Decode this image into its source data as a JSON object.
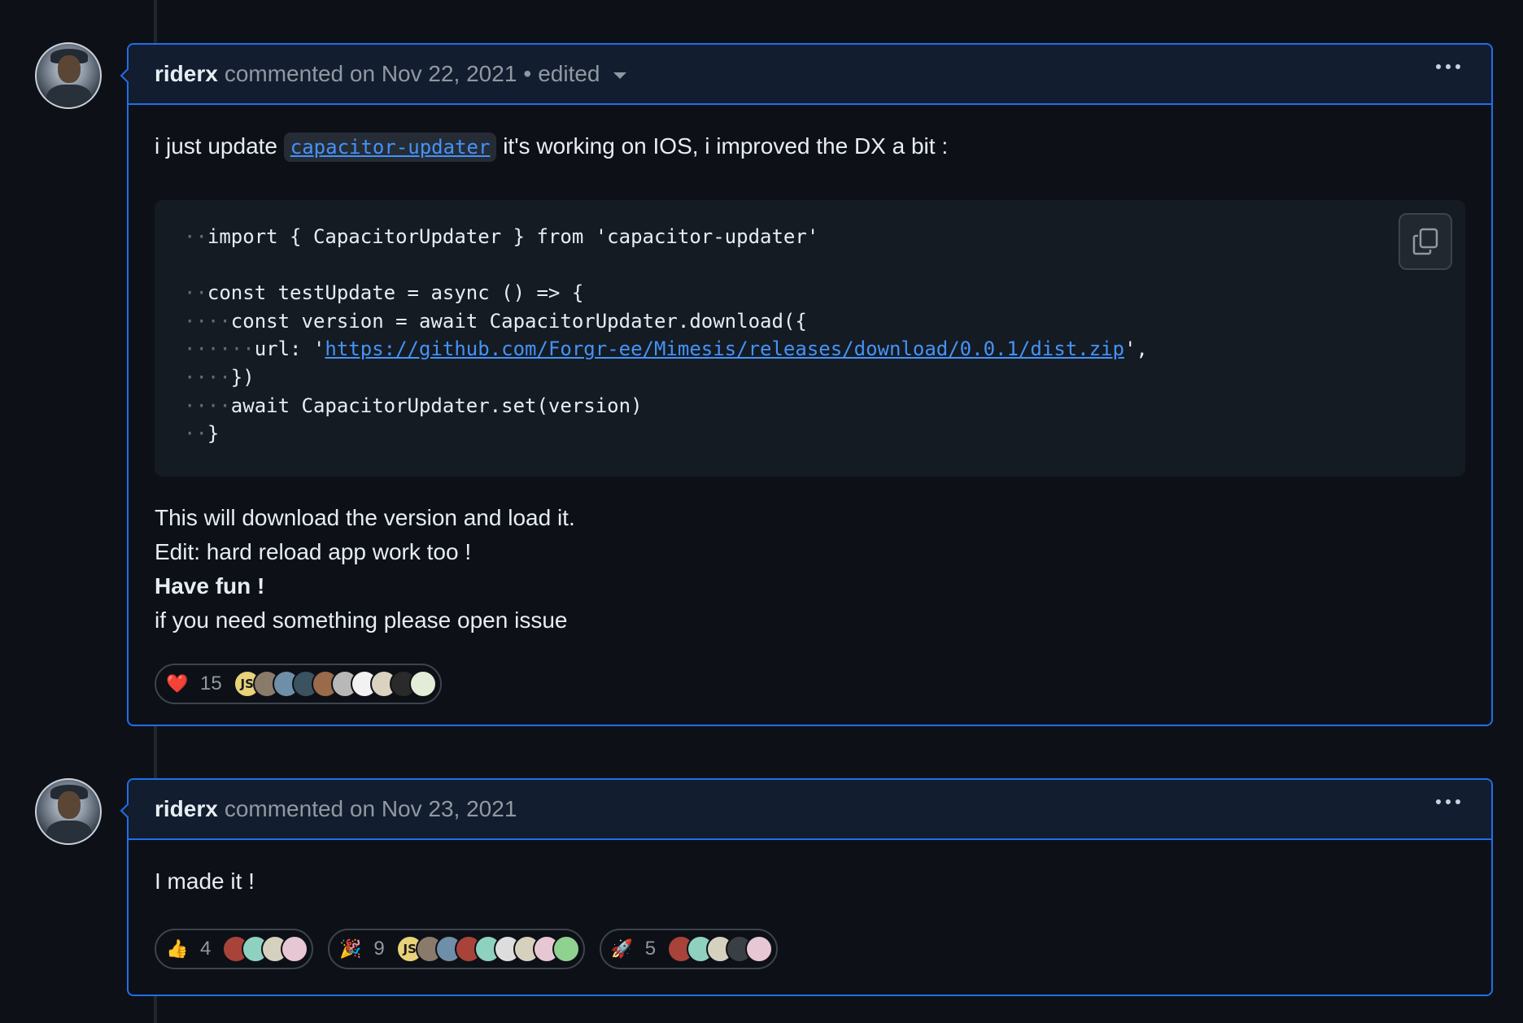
{
  "comments": [
    {
      "author": "riderx",
      "meta": "commented on Nov 22, 2021",
      "edited": "edited",
      "intro_before": "i just update",
      "intro_code": "capacitor-updater",
      "intro_after": "it's working on IOS, i improved the DX a bit :",
      "code": {
        "l1": "import { CapacitorUpdater } from 'capacitor-updater'",
        "l3": "const testUpdate = async () => {",
        "l4": "const version = await CapacitorUpdater.download({",
        "l5_pre": "url: '",
        "l5_url": "https://github.com/Forgr-ee/Mimesis/releases/download/0.0.1/dist.zip",
        "l5_post": "',",
        "l6": "})",
        "l7": "await CapacitorUpdater.set(version)",
        "l8": "}"
      },
      "lines": [
        "This will download the version and load it.",
        "Edit: hard reload app work too !",
        "Have fun !",
        "if you need something please open issue"
      ],
      "reactions": [
        {
          "emoji": "heart",
          "glyph": "❤️",
          "count": "15"
        }
      ]
    },
    {
      "author": "riderx",
      "meta": "commented on Nov 23, 2021",
      "body": "I made it !",
      "reactions": [
        {
          "emoji": "thumbs-up",
          "glyph": "👍",
          "count": "4"
        },
        {
          "emoji": "party-popper",
          "glyph": "🎉",
          "count": "9"
        },
        {
          "emoji": "rocket",
          "glyph": "🚀",
          "count": "5"
        }
      ]
    }
  ],
  "avatar_badge_text": "JS",
  "colors": {
    "accent": "#1f6feb",
    "link": "#4493f8",
    "background": "#0d1117"
  }
}
